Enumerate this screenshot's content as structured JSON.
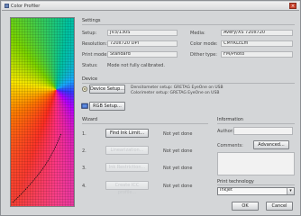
{
  "window": {
    "title": "Color Profiler"
  },
  "settings": {
    "section_label": "Settings",
    "setup_label": "Setup:",
    "setup_value": "JV3/130S",
    "resolution_label": "Resolution:",
    "resolution_value": "720x720 DPI",
    "print_mode_label": "Print mode:",
    "print_mode_value": "Standard",
    "status_label": "Status:",
    "status_value": "Mode not fully calibrated.",
    "media_label": "Media:",
    "media_value": "Avery/XS 720x720",
    "color_mode_label": "Color mode:",
    "color_mode_value": "CMYKLcLm",
    "dither_label": "Dither type:",
    "dither_value": "FM/Photo"
  },
  "device": {
    "section_label": "Device",
    "device_setup_button": "Device Setup...",
    "densitometer_text": "Densitometer setup: GRETAG EyeOne on USB",
    "colorimeter_text": "Colorimeter setup: GRETAG EyeOne on USB",
    "rgb_setup_button": "RGB Setup..."
  },
  "wizard": {
    "section_label": "Wizard",
    "steps": [
      {
        "number": "1.",
        "button": "Find Ink Limit...",
        "status": "Not yet done"
      },
      {
        "number": "2.",
        "button": "Linearization...",
        "status": "Not yet done"
      },
      {
        "number": "3.",
        "button": "Ink Restriction...",
        "status": "Not yet done"
      },
      {
        "number": "4.",
        "button": "Create ICC profile...",
        "status": "Not yet done"
      }
    ]
  },
  "information": {
    "section_label": "Information",
    "author_label": "Author:",
    "comments_label": "Comments:",
    "advanced_button": "Advanced..."
  },
  "print_technology": {
    "section_label": "Print technology",
    "selected": "Inkjet"
  },
  "footer": {
    "ok_button": "OK",
    "cancel_button": "Cancel"
  },
  "colors": {
    "window_bg": "#d4d6d8",
    "close_button": "#c8412b"
  }
}
